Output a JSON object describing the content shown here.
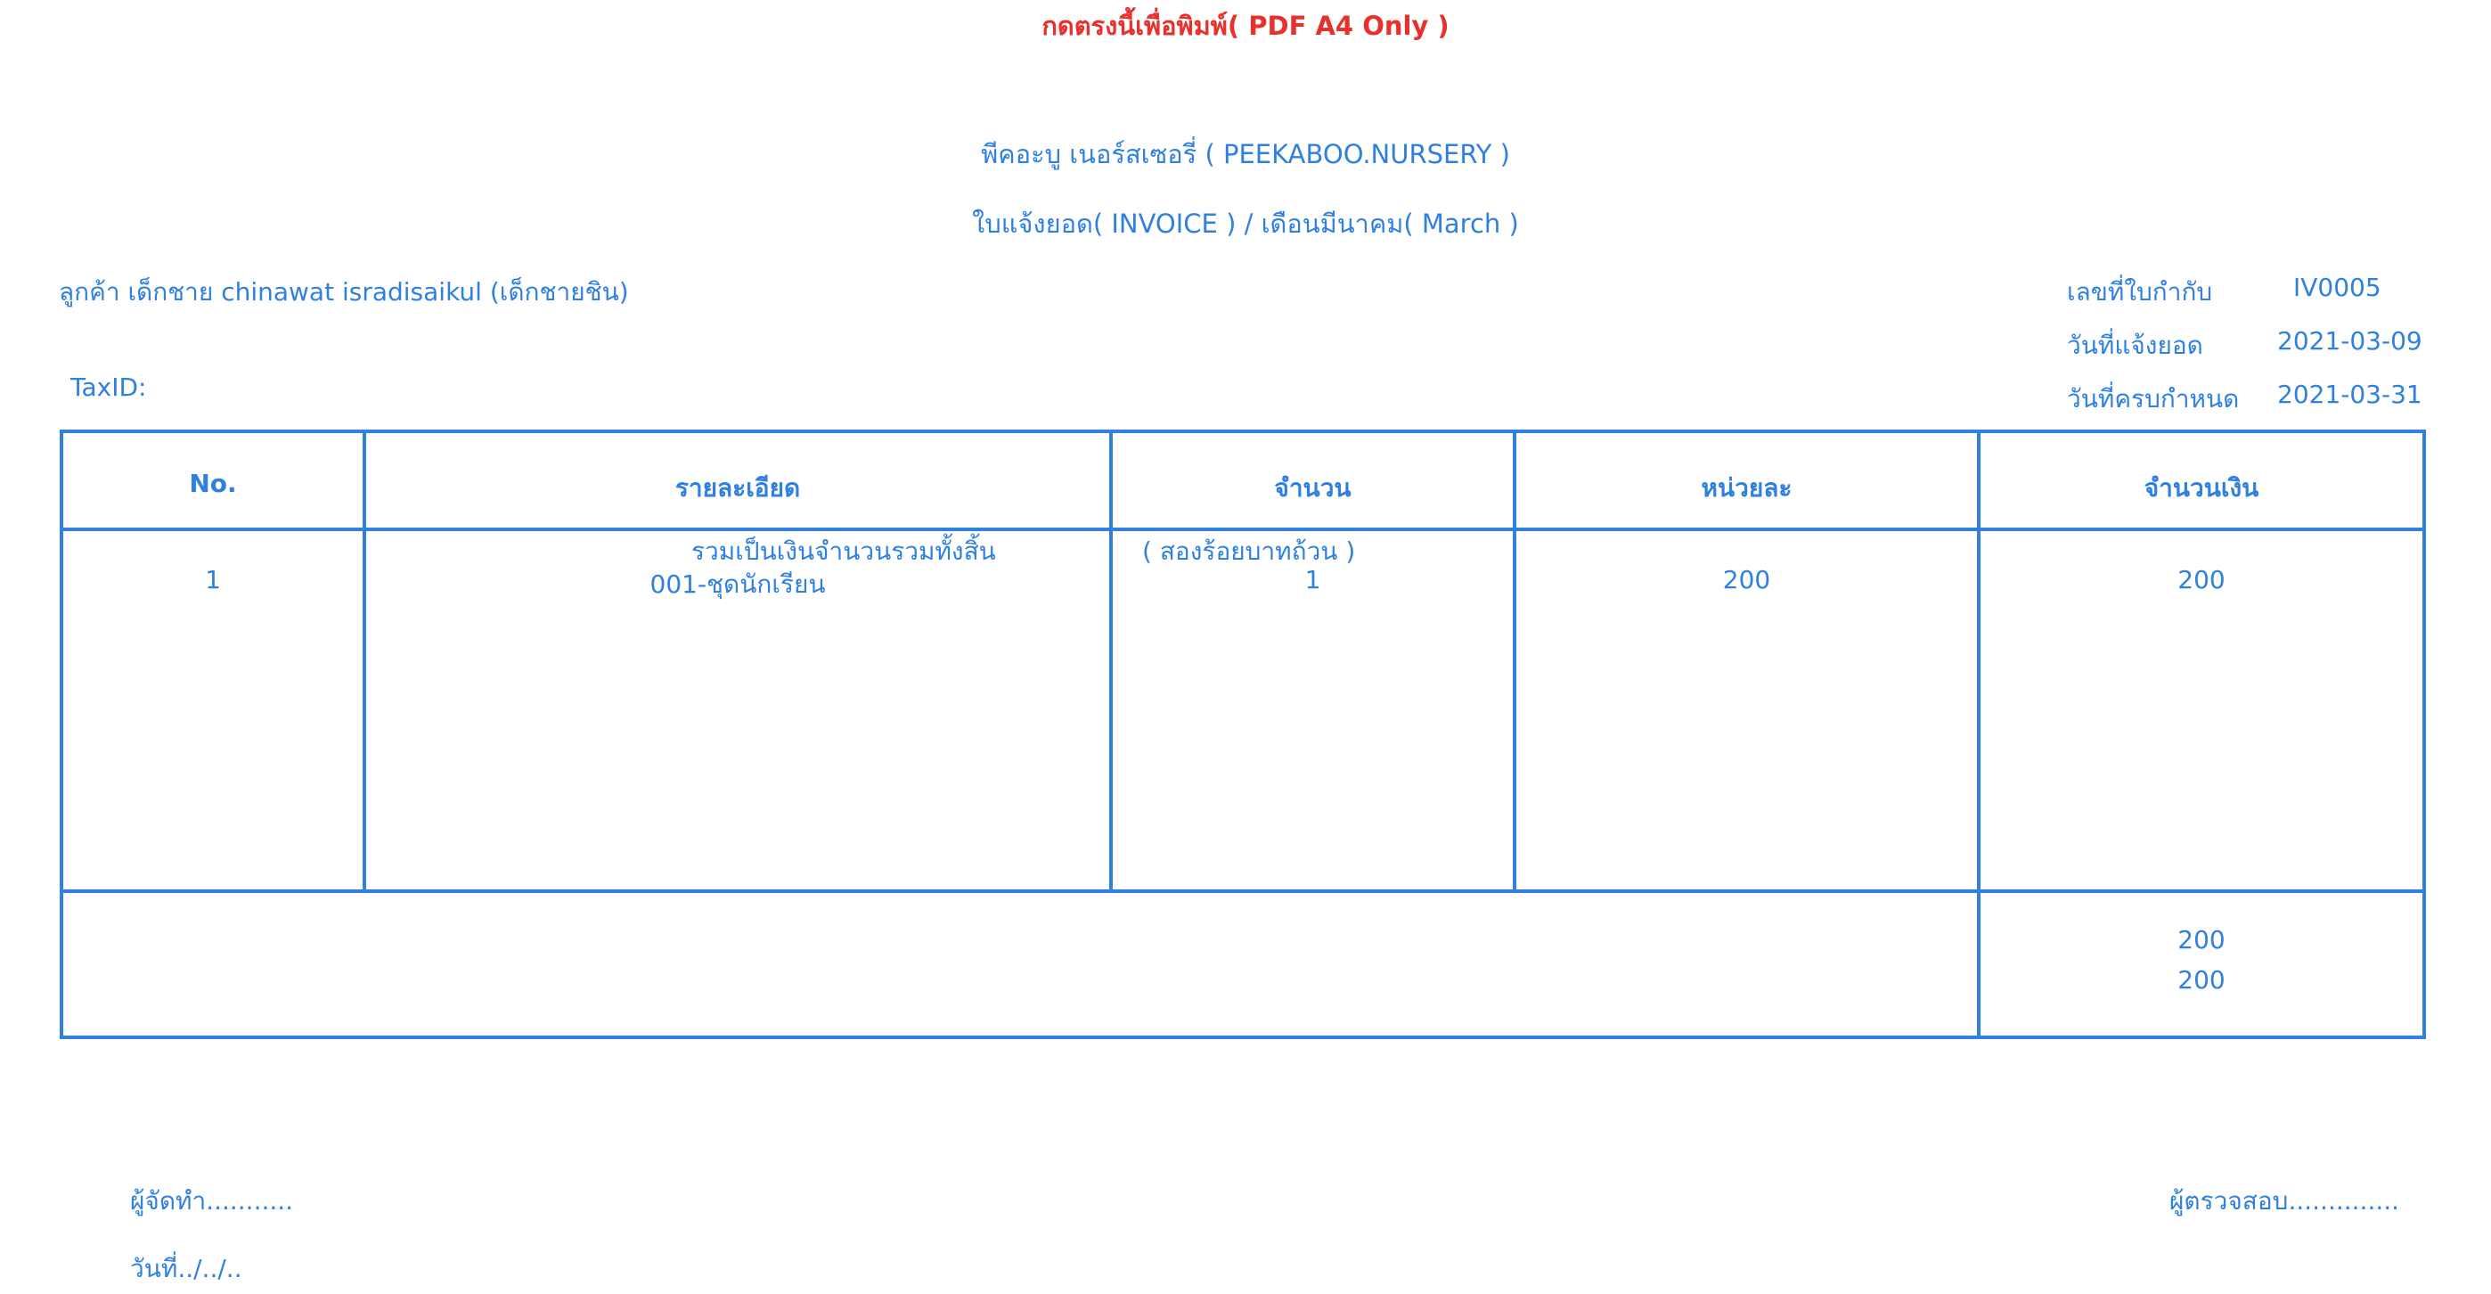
{
  "header": {
    "print_link": "กดตรงนี้เพื่อพิมพ์( PDF A4 Only )",
    "company": "พีคอะบู เนอร์สเซอรี่ ( PEEKABOO.NURSERY )",
    "doc_title": "ใบแจ้งยอด( INVOICE ) / เดือนมีนาคม( March )"
  },
  "customer": {
    "line": "ลูกค้า เด็กชาย chinawat isradisaikul (เด็กชายชิน)",
    "taxid": "TaxID:"
  },
  "meta": {
    "invoice_no_label": "เลขที่ใบกำกับ",
    "invoice_no": "IV0005",
    "issue_date_label": "วันที่แจ้งยอด",
    "issue_date": "2021-03-09",
    "due_date_label": "วันที่ครบกำหนด",
    "due_date": "2021-03-31"
  },
  "table": {
    "columns": [
      "No.",
      "รายละเอียด",
      "จำนวน",
      "หน่วยละ",
      "จำนวนเงิน"
    ],
    "rows": [
      {
        "no": "1",
        "detail": "001-ชุดนักเรียน",
        "qty": "1",
        "unit_price": "200",
        "amount": "200"
      }
    ],
    "total_label": "รวมเป็นเงินจำนวนรวมทั้งสิ้น",
    "total_words": "( สองร้อยบาทถ้วน )",
    "subtotal": "200",
    "grand_total": "200"
  },
  "signatures": {
    "prepared_by": "ผู้จัดทำ...........",
    "checked_by": "ผู้ตรวจสอบ..............",
    "date": "วันที่../../.."
  },
  "colors": {
    "primary": "#2f80e0",
    "print_link": "#e8312d"
  }
}
